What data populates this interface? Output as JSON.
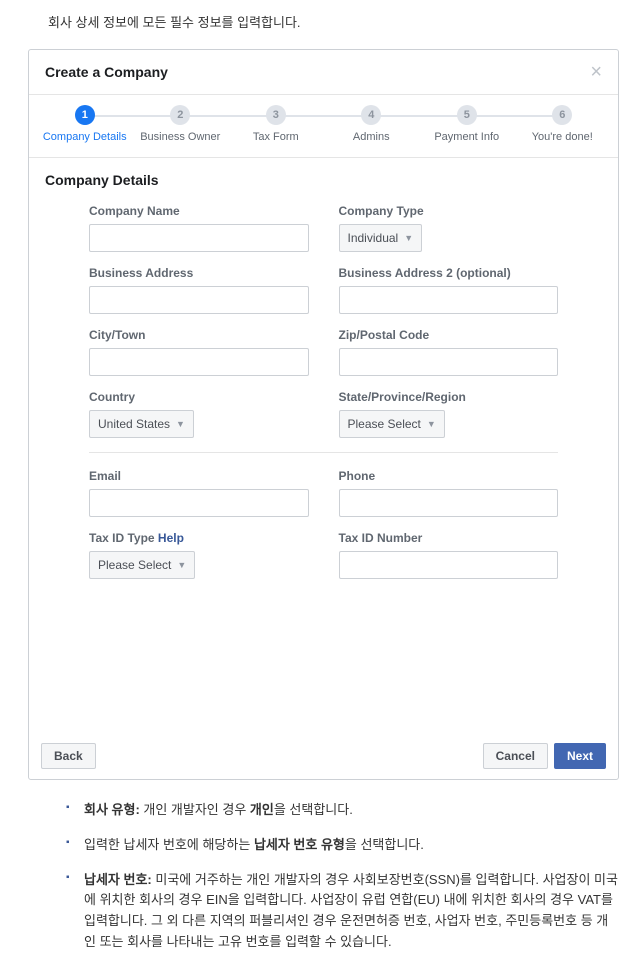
{
  "intro": "회사 상세 정보에 모든 필수 정보를 입력합니다.",
  "dialog": {
    "title": "Create a Company",
    "steps": [
      {
        "num": "1",
        "label": "Company Details",
        "active": true
      },
      {
        "num": "2",
        "label": "Business Owner",
        "active": false
      },
      {
        "num": "3",
        "label": "Tax Form",
        "active": false
      },
      {
        "num": "4",
        "label": "Admins",
        "active": false
      },
      {
        "num": "5",
        "label": "Payment Info",
        "active": false
      },
      {
        "num": "6",
        "label": "You're done!",
        "active": false
      }
    ],
    "sectionTitle": "Company Details",
    "labels": {
      "companyName": "Company Name",
      "companyType": "Company Type",
      "companyTypeValue": "Individual",
      "businessAddress": "Business Address",
      "businessAddress2": "Business Address 2 (optional)",
      "cityTown": "City/Town",
      "zip": "Zip/Postal Code",
      "country": "Country",
      "countryValue": "United States",
      "state": "State/Province/Region",
      "stateValue": "Please Select",
      "email": "Email",
      "phone": "Phone",
      "taxIdType": "Tax ID Type",
      "taxIdTypeValue": "Please Select",
      "taxIdNumber": "Tax ID Number",
      "help": "Help"
    },
    "buttons": {
      "back": "Back",
      "cancel": "Cancel",
      "next": "Next"
    }
  },
  "bullets": {
    "b1_bold": "회사 유형:",
    "b1_text": " 개인 개발자인 경우 ",
    "b1_bold2": "개인",
    "b1_text2": "을 선택합니다.",
    "b2_text": "입력한 납세자 번호에 해당하는 ",
    "b2_bold": "납세자 번호 유형",
    "b2_text2": "을 선택합니다.",
    "b3_bold": "납세자 번호:",
    "b3_text": " 미국에 거주하는 개인 개발자의 경우 사회보장번호(SSN)를 입력합니다. 사업장이 미국에 위치한 회사의 경우 EIN을 입력합니다. 사업장이 유럽 연합(EU) 내에 위치한 회사의 경우 VAT를 입력합니다. 그 외 다른 지역의 퍼블리셔인 경우 운전면허증 번호, 사업자 번호, 주민등록번호 등 개인 또는 회사를 나타내는 고유 번호를 입력할 수 있습니다."
  }
}
